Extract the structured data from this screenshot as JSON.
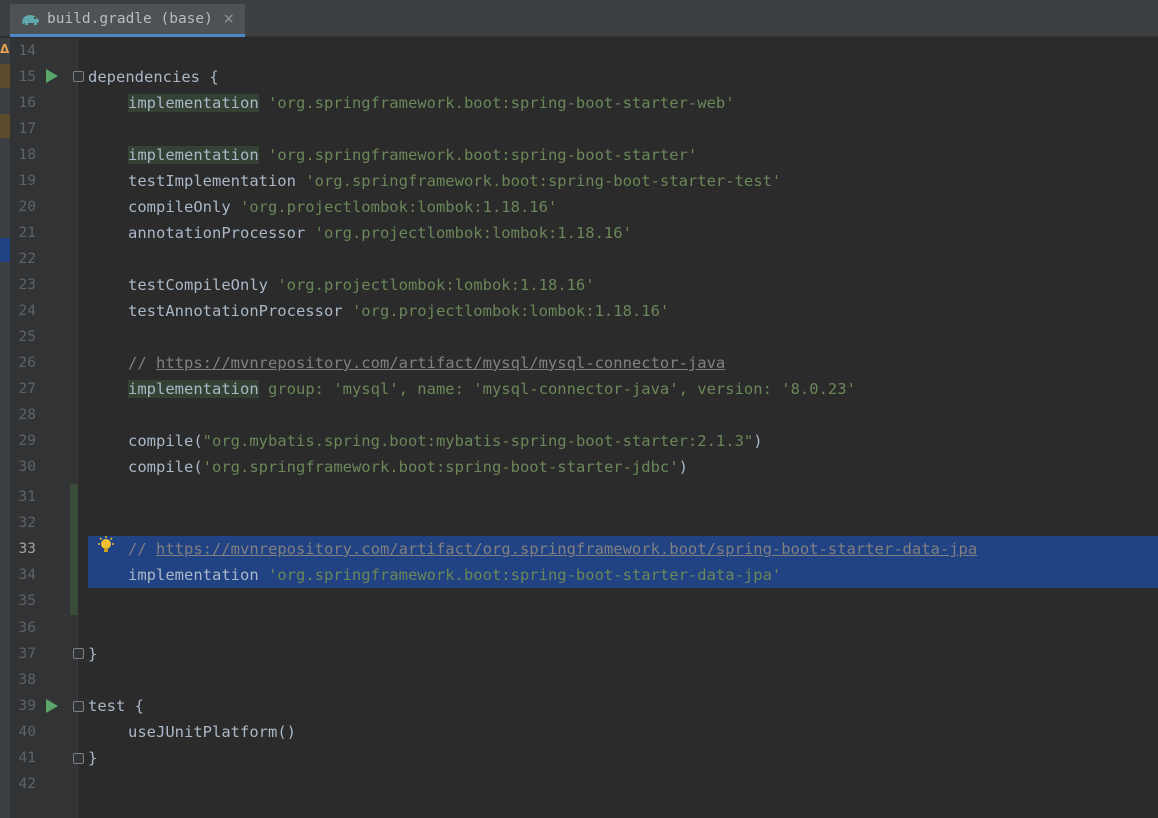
{
  "tab": {
    "label": "build.gradle (base)",
    "close": "×",
    "icon": "gradle-elephant-icon"
  },
  "gutter": {
    "warning": "Δ"
  },
  "lines": [
    {
      "num": "14"
    },
    {
      "num": "15",
      "t1": "dependencies {"
    },
    {
      "num": "16",
      "kw": "implementation",
      "rest": " 'org.springframework.boot:spring-boot-starter-web'"
    },
    {
      "num": "17"
    },
    {
      "num": "18",
      "kw": "implementation",
      "rest": " 'org.springframework.boot:spring-boot-starter'"
    },
    {
      "num": "19",
      "kw": "testImplementation",
      "rest": " 'org.springframework.boot:spring-boot-starter-test'"
    },
    {
      "num": "20",
      "kw": "compileOnly",
      "rest": " 'org.projectlombok:lombok:1.18.16'"
    },
    {
      "num": "21",
      "kw": "annotationProcessor",
      "rest": " 'org.projectlombok:lombok:1.18.16'"
    },
    {
      "num": "22"
    },
    {
      "num": "23",
      "kw": "testCompileOnly",
      "rest": " 'org.projectlombok:lombok:1.18.16'"
    },
    {
      "num": "24",
      "kw": "testAnnotationProcessor",
      "rest": " 'org.projectlombok:lombok:1.18.16'"
    },
    {
      "num": "25"
    },
    {
      "num": "26",
      "cmt": "// ",
      "url": "https://mvnrepository.com/artifact/mysql/mysql-connector-java"
    },
    {
      "num": "27",
      "kw": "implementation",
      "p1": " group: ",
      "s1": "'mysql'",
      "p2": ", name: ",
      "s2": "'mysql-connector-java'",
      "p3": ", version: ",
      "s3": "'8.0.23'"
    },
    {
      "num": "28"
    },
    {
      "num": "29",
      "kw": "compile",
      "o": "(",
      "s": "\"org.mybatis.spring.boot:mybatis-spring-boot-starter:2.1.3\"",
      "c": ")"
    },
    {
      "num": "30",
      "kw": "compile",
      "o": "(",
      "s": "'org.springframework.boot:spring-boot-starter-jdbc'",
      "c": ")"
    },
    {
      "num": "31"
    },
    {
      "num": "32"
    },
    {
      "num": "33",
      "cmt": "// ",
      "url": "https://mvnrepository.com/artifact/org.springframework.boot/spring-boot-starter-data-jpa"
    },
    {
      "num": "34",
      "kw": "implementation",
      "rest": " 'org.springframework.boot:spring-boot-starter-data-jpa'"
    },
    {
      "num": "35"
    },
    {
      "num": "36"
    },
    {
      "num": "37",
      "t1": "}"
    },
    {
      "num": "38"
    },
    {
      "num": "39",
      "t1": "test {"
    },
    {
      "num": "40",
      "kw": "useJUnitPlatform",
      "rest": "()"
    },
    {
      "num": "41",
      "t1": "}"
    },
    {
      "num": "42"
    }
  ],
  "colors": {
    "selection": "#214283",
    "string": "#6a8759",
    "comment": "#808080",
    "run": "#59a869"
  }
}
